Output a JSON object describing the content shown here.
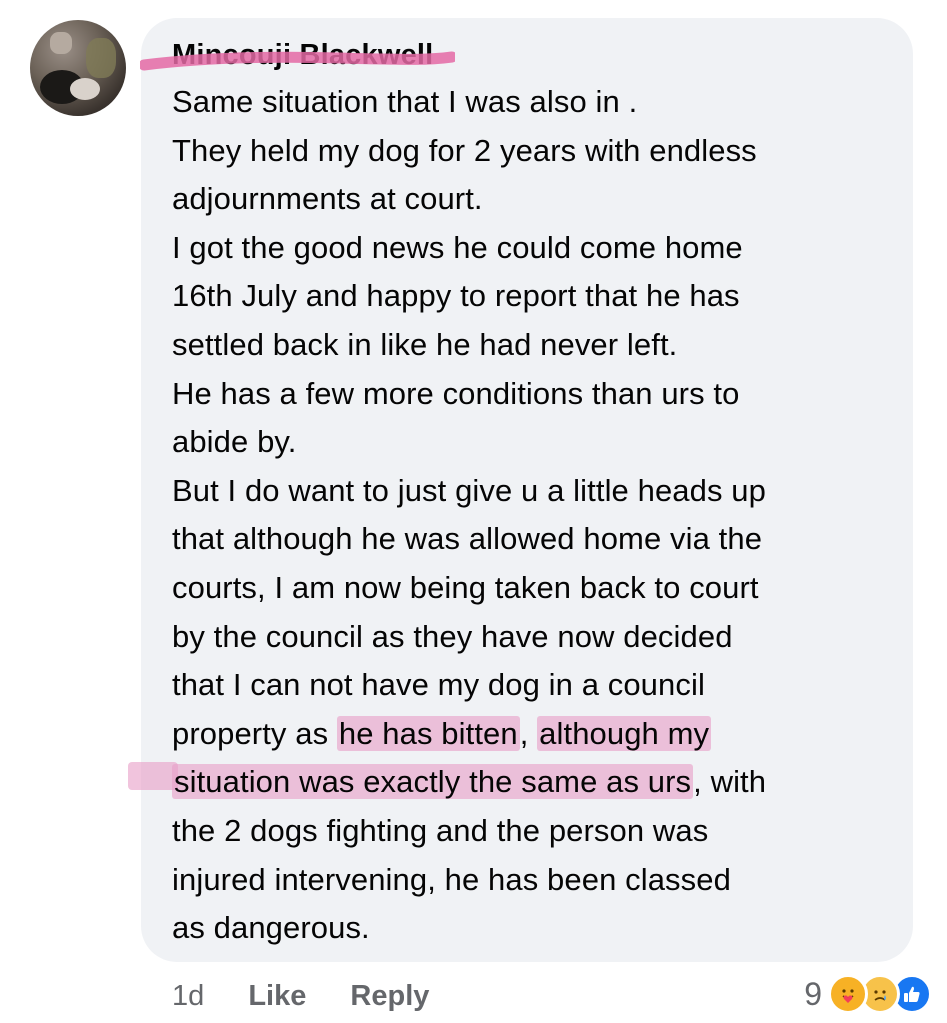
{
  "comment": {
    "author": "Mincouji Blackwell",
    "lines": [
      "Same situation that I was also in .",
      "They held my dog for 2 years with endless",
      "adjournments at court.",
      "I got the good news he could come home",
      "16th  July and happy to report that he has",
      "settled back in like he had never left.",
      "He has a few more conditions than urs to",
      "abide by.",
      "But I do want to just give u a little heads up",
      "that although he was allowed home via the",
      "courts, I am now being taken back to court",
      "by the council as they have now decided",
      "that I can not have my dog in a council"
    ],
    "line14": {
      "pre": "property as ",
      "hl1": "he has bitten",
      "mid": ", ",
      "hl2": "although my"
    },
    "line15": {
      "hl": "situation was exactly the same as urs",
      "post": ", with"
    },
    "tail_lines": [
      "the 2 dogs fighting and the person was",
      "injured intervening,  he has been classed",
      "as dangerous."
    ]
  },
  "meta": {
    "time": "1d",
    "like_label": "Like",
    "reply_label": "Reply"
  },
  "reactions": {
    "count": "9",
    "icons": [
      "care-icon",
      "sad-icon",
      "like-icon"
    ]
  },
  "colors": {
    "bubble": "#f0f2f5",
    "highlight": "#e9a0c8",
    "meta_text": "#65676b",
    "like_blue": "#1877f2"
  }
}
